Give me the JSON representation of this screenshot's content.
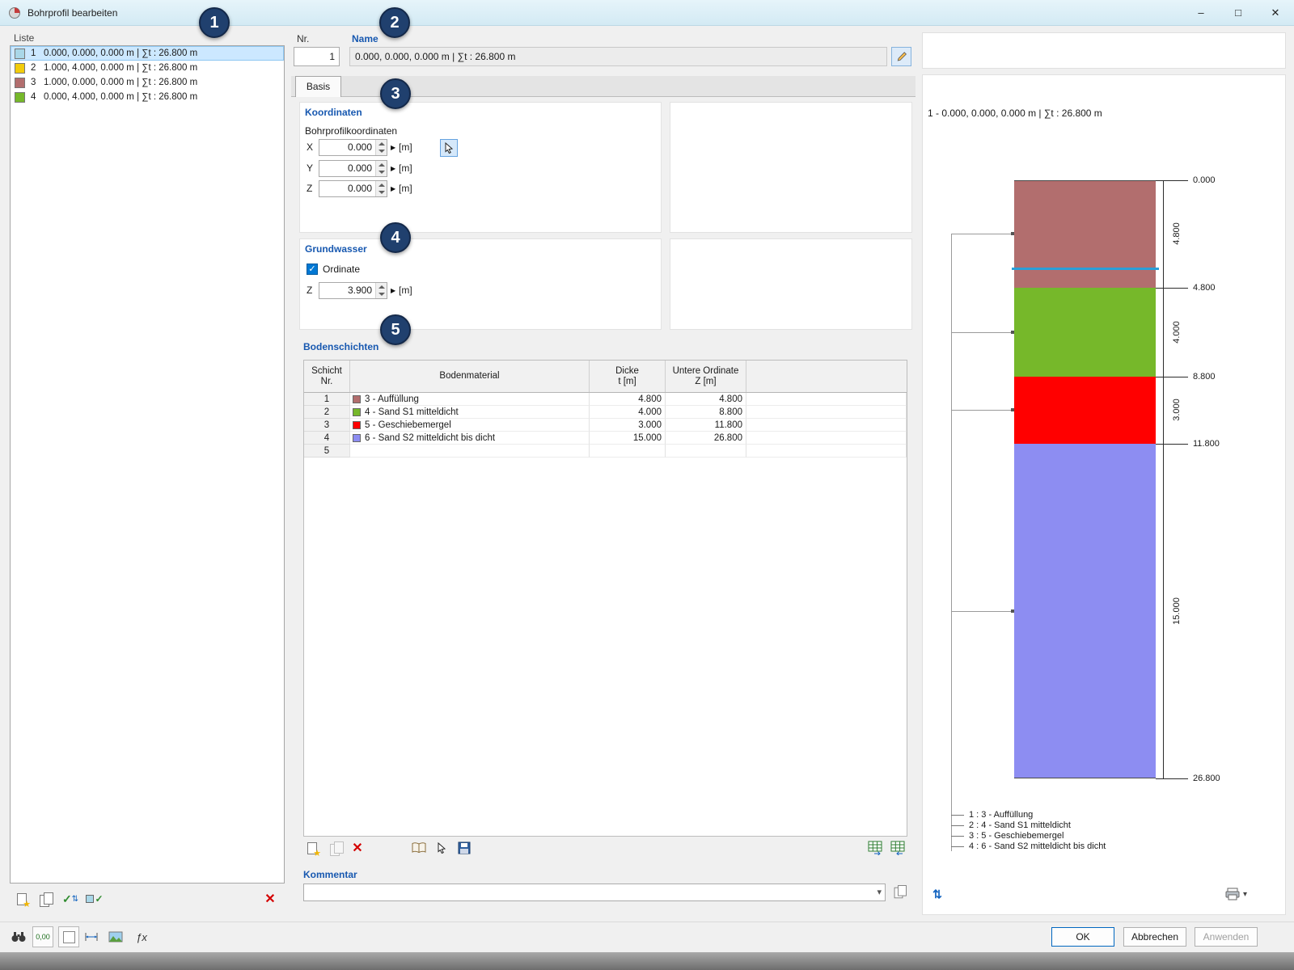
{
  "window": {
    "title": "Bohrprofil bearbeiten"
  },
  "icons": {
    "minimize": "–",
    "maximize": "□",
    "close": "✕",
    "delete": "✕",
    "dropdown": "▾",
    "flyout": "▶",
    "check": "✓",
    "fx": "ƒx",
    "zero": "0,00",
    "swap": "⇅"
  },
  "list": {
    "label": "Liste",
    "items": [
      {
        "nr": "1",
        "text": "0.000, 0.000, 0.000 m | ∑t : 26.800 m",
        "color": "#a9d7e8",
        "selected": true
      },
      {
        "nr": "2",
        "text": "1.000, 4.000, 0.000 m | ∑t : 26.800 m",
        "color": "#f2cc0c",
        "selected": false
      },
      {
        "nr": "3",
        "text": "1.000, 0.000, 0.000 m | ∑t : 26.800 m",
        "color": "#b26e6e",
        "selected": false
      },
      {
        "nr": "4",
        "text": "0.000, 4.000, 0.000 m | ∑t : 26.800 m",
        "color": "#76b82a",
        "selected": false
      }
    ]
  },
  "header": {
    "nr_label": "Nr.",
    "nr_value": "1",
    "name_label": "Name",
    "name_value": "0.000, 0.000, 0.000 m | ∑t : 26.800 m"
  },
  "tab": {
    "basis": "Basis"
  },
  "koordinaten": {
    "heading": "Koordinaten",
    "subheading": "Bohrprofilkoordinaten",
    "x_label": "X",
    "x_value": "0.000",
    "y_label": "Y",
    "y_value": "0.000",
    "z_label": "Z",
    "z_value": "0.000",
    "unit": "[m]"
  },
  "grundwasser": {
    "heading": "Grundwasser",
    "ordinate_label": "Ordinate",
    "ordinate_checked": true,
    "z_label": "Z",
    "z_value": "3.900",
    "unit": "[m]"
  },
  "bodenschichten": {
    "heading": "Bodenschichten",
    "columns": {
      "schicht_line1": "Schicht",
      "schicht_line2": "Nr.",
      "material": "Bodenmaterial",
      "dicke_line1": "Dicke",
      "dicke_line2": "t [m]",
      "untere_line1": "Untere Ordinate",
      "untere_line2": "Z [m]"
    },
    "rows": [
      {
        "nr": "1",
        "color": "#b26e6e",
        "material": "3 - Auffüllung",
        "dicke": "4.800",
        "untere": "4.800"
      },
      {
        "nr": "2",
        "color": "#76b82a",
        "material": "4 - Sand S1 mitteldicht",
        "dicke": "4.000",
        "untere": "8.800"
      },
      {
        "nr": "3",
        "color": "#ff0000",
        "material": "5 - Geschiebemergel",
        "dicke": "3.000",
        "untere": "11.800"
      },
      {
        "nr": "4",
        "color": "#8d8df2",
        "material": "6 - Sand S2 mitteldicht bis dicht",
        "dicke": "15.000",
        "untere": "26.800"
      },
      {
        "nr": "5",
        "color": "",
        "material": "",
        "dicke": "",
        "untere": ""
      }
    ]
  },
  "kommentar": {
    "heading": "Kommentar",
    "value": ""
  },
  "profile": {
    "title": "1 - 0.000, 0.000, 0.000 m | ∑t : 26.800 m",
    "total_depth": 26.8,
    "top_label": "0.000",
    "groundwater_z": 3.9,
    "layers": [
      {
        "name": "3 - Auffüllung",
        "color": "#b26e6e",
        "thickness": 4.8,
        "thickness_label": "4.800",
        "bottom_label": "4.800"
      },
      {
        "name": "4 - Sand S1 mitteldicht",
        "color": "#76b82a",
        "thickness": 4.0,
        "thickness_label": "4.000",
        "bottom_label": "8.800"
      },
      {
        "name": "5 - Geschiebemergel",
        "color": "#ff0000",
        "thickness": 3.0,
        "thickness_label": "3.000",
        "bottom_label": "11.800"
      },
      {
        "name": "6 - Sand S2 mitteldicht bis dicht",
        "color": "#8d8df2",
        "thickness": 15.0,
        "thickness_label": "15.000",
        "bottom_label": "26.800"
      }
    ],
    "legend": [
      "1 :  3 - Auffüllung",
      "2 :  4 - Sand S1 mitteldicht",
      "3 :  5 - Geschiebemergel",
      "4 :  6 - Sand S2 mitteldicht bis dicht"
    ]
  },
  "footer": {
    "ok": "OK",
    "cancel": "Abbrechen",
    "apply": "Anwenden"
  },
  "callouts": [
    "1",
    "2",
    "3",
    "4",
    "5"
  ]
}
